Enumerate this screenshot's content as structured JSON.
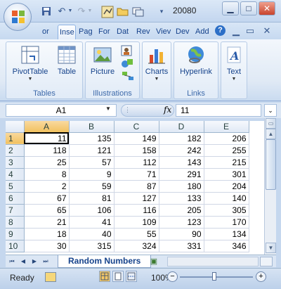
{
  "window": {
    "title": "20080"
  },
  "quick_access": {
    "icons": [
      "save-icon",
      "undo-icon",
      "redo-icon",
      "toolbar-icon",
      "open-icon",
      "window-icon",
      "customize-arrow-icon"
    ]
  },
  "tabs": [
    {
      "label": "or"
    },
    {
      "label": "Inse"
    },
    {
      "label": "Pag"
    },
    {
      "label": "For"
    },
    {
      "label": "Dat"
    },
    {
      "label": "Rev"
    },
    {
      "label": "Viev"
    },
    {
      "label": "Dev"
    },
    {
      "label": "Add"
    }
  ],
  "ribbon": {
    "groups": {
      "tables": {
        "label": "Tables",
        "pivottable": "PivotTable",
        "table": "Table"
      },
      "illustrations": {
        "label": "Illustrations",
        "picture": "Picture"
      },
      "charts": {
        "label": "",
        "charts": "Charts"
      },
      "links": {
        "label": "Links",
        "hyperlink": "Hyperlink"
      },
      "text": {
        "label": "",
        "text": "Text"
      }
    }
  },
  "formula_bar": {
    "name_box": "A1",
    "fx": "fx",
    "value": "11"
  },
  "grid": {
    "columns": [
      "A",
      "B",
      "C",
      "D",
      "E"
    ],
    "rows": [
      {
        "row": "1",
        "cells": [
          "11",
          "135",
          "149",
          "182",
          "206"
        ]
      },
      {
        "row": "2",
        "cells": [
          "118",
          "121",
          "158",
          "242",
          "255"
        ]
      },
      {
        "row": "3",
        "cells": [
          "25",
          "57",
          "112",
          "143",
          "215"
        ]
      },
      {
        "row": "4",
        "cells": [
          "8",
          "9",
          "71",
          "291",
          "301"
        ]
      },
      {
        "row": "5",
        "cells": [
          "2",
          "59",
          "87",
          "180",
          "204"
        ]
      },
      {
        "row": "6",
        "cells": [
          "67",
          "81",
          "127",
          "133",
          "140"
        ]
      },
      {
        "row": "7",
        "cells": [
          "65",
          "106",
          "116",
          "205",
          "305"
        ]
      },
      {
        "row": "8",
        "cells": [
          "21",
          "41",
          "109",
          "123",
          "170"
        ]
      },
      {
        "row": "9",
        "cells": [
          "18",
          "40",
          "55",
          "90",
          "134"
        ]
      },
      {
        "row": "10",
        "cells": [
          "30",
          "315",
          "324",
          "331",
          "346"
        ]
      }
    ],
    "active_cell": "A1"
  },
  "sheets": {
    "active": "Random Numbers"
  },
  "status_bar": {
    "ready": "Ready",
    "zoom": "100%",
    "zoom_minus": "−",
    "zoom_plus": "+"
  },
  "colors": {
    "accent": "#15428b",
    "selected_header": "#f1c15f",
    "ribbon_bg": "#dfe9f5"
  }
}
